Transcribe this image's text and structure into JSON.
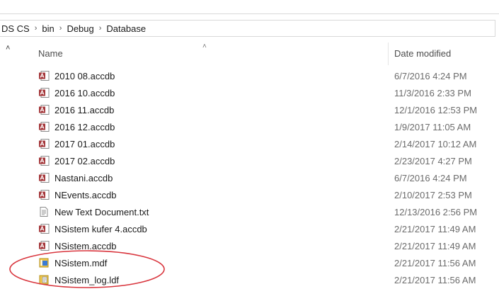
{
  "breadcrumb": [
    "DS CS",
    "bin",
    "Debug",
    "Database"
  ],
  "breadcrumb_separator": "›",
  "header": {
    "name_label": "Name",
    "date_label": "Date modified"
  },
  "files": [
    {
      "name": "2010 08.accdb",
      "date": "6/7/2016 4:24 PM",
      "icon": "access-database-icon"
    },
    {
      "name": "2016 10.accdb",
      "date": "11/3/2016 2:33 PM",
      "icon": "access-database-icon"
    },
    {
      "name": "2016 11.accdb",
      "date": "12/1/2016 12:53 PM",
      "icon": "access-database-icon"
    },
    {
      "name": "2016 12.accdb",
      "date": "1/9/2017 11:05 AM",
      "icon": "access-database-icon"
    },
    {
      "name": "2017 01.accdb",
      "date": "2/14/2017 10:12 AM",
      "icon": "access-database-icon"
    },
    {
      "name": "2017 02.accdb",
      "date": "2/23/2017 4:27 PM",
      "icon": "access-database-icon"
    },
    {
      "name": "Nastani.accdb",
      "date": "6/7/2016 4:24 PM",
      "icon": "access-database-icon"
    },
    {
      "name": "NEvents.accdb",
      "date": "2/10/2017 2:53 PM",
      "icon": "access-database-icon"
    },
    {
      "name": "New Text Document.txt",
      "date": "12/13/2016 2:56 PM",
      "icon": "text-document-icon"
    },
    {
      "name": "NSistem kufer 4.accdb",
      "date": "2/21/2017 11:49 AM",
      "icon": "access-database-icon"
    },
    {
      "name": "NSistem.accdb",
      "date": "2/21/2017 11:49 AM",
      "icon": "access-database-icon"
    },
    {
      "name": "NSistem.mdf",
      "date": "2/21/2017 11:56 AM",
      "icon": "sql-database-file-icon"
    },
    {
      "name": "NSistem_log.ldf",
      "date": "2/21/2017 11:56 AM",
      "icon": "sql-log-file-icon"
    }
  ],
  "colors": {
    "highlight": "#d9363e",
    "access_icon": "#a4373a",
    "sql_icon_yellow": "#f2c94c",
    "sql_icon_blue": "#3a7bd5"
  }
}
